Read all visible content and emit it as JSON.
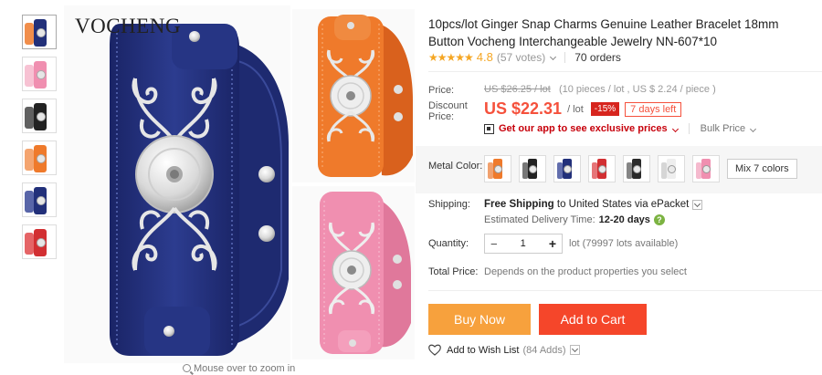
{
  "brand": {
    "logo": "VOCHENG"
  },
  "gallery": {
    "zoom_hint": "Mouse over to zoom in",
    "thumbnails": [
      {
        "name": "thumb-blue-orange",
        "color": "#22307a",
        "color2": "#ef7a2b"
      },
      {
        "name": "thumb-pink",
        "color": "#f08fb0",
        "color2": "#f6b7cb"
      },
      {
        "name": "thumb-black",
        "color": "#222222",
        "color2": "#444444"
      },
      {
        "name": "thumb-orange",
        "color": "#ef7a2b",
        "color2": "#f29456"
      },
      {
        "name": "thumb-blue",
        "color": "#22307a",
        "color2": "#3b4a99"
      },
      {
        "name": "thumb-red",
        "color": "#d22f32",
        "color2": "#e0494b"
      }
    ]
  },
  "product": {
    "title": "10pcs/lot Ginger Snap Charms Genuine Leather Bracelet 18mm Button Vocheng Interchangeable Jewelry NN-607*10",
    "stars": "★★★★★",
    "rating": "4.8",
    "votes": "(57 votes)",
    "orders": "70 orders"
  },
  "pricing": {
    "price_label": "Price:",
    "original_price": "US $26.25 / lot",
    "original_detail": "(10 pieces / lot , US $ 2.24 / piece )",
    "discount_label_1": "Discount",
    "discount_label_2": "Price:",
    "discount_price": "US $22.31",
    "per_lot": "/ lot",
    "discount_badge": "-15%",
    "days_left": "7 days left",
    "app_link": "Get our app to see exclusive prices",
    "bulk_price": "Bulk Price"
  },
  "options": {
    "metal_color_label": "Metal Color:",
    "swatches": [
      {
        "name": "swatch-orange",
        "color": "#ef7a2b",
        "color2": "#ee8a4a"
      },
      {
        "name": "swatch-black",
        "color": "#222222",
        "color2": "#555555"
      },
      {
        "name": "swatch-blue",
        "color": "#22307a",
        "color2": "#3b4a99"
      },
      {
        "name": "swatch-red",
        "color": "#d22f32",
        "color2": "#e05356"
      },
      {
        "name": "swatch-black-2",
        "color": "#2a2a2a",
        "color2": "#666666"
      },
      {
        "name": "swatch-white",
        "color": "#eeeeee",
        "color2": "#cccccc"
      },
      {
        "name": "swatch-pink",
        "color": "#f08fb0",
        "color2": "#f3a9c2"
      }
    ],
    "mix_label": "Mix 7 colors"
  },
  "shipping": {
    "label": "Shipping:",
    "free": "Free Shipping",
    "to_country": "to United States via ePacket",
    "eta_label": "Estimated Delivery Time:",
    "eta_days": "12-20 days",
    "help": "?"
  },
  "quantity": {
    "label": "Quantity:",
    "value": "1",
    "minus": "−",
    "plus": "+",
    "available": "lot (79997 lots available)"
  },
  "total": {
    "label": "Total Price:",
    "value": "Depends on the product properties you select"
  },
  "actions": {
    "buy_now": "Buy Now",
    "add_to_cart": "Add to Cart",
    "wish_list": "Add to Wish List",
    "wish_count": "(84 Adds)"
  },
  "colors": {
    "price_red": "#f5513c",
    "buy_orange": "#f7a13d",
    "cart_red": "#f5462a",
    "star_gold": "#f5a623",
    "bracelet_blue": "#22307a",
    "bracelet_orange": "#ef7a2b",
    "bracelet_pink": "#f08fb0"
  }
}
